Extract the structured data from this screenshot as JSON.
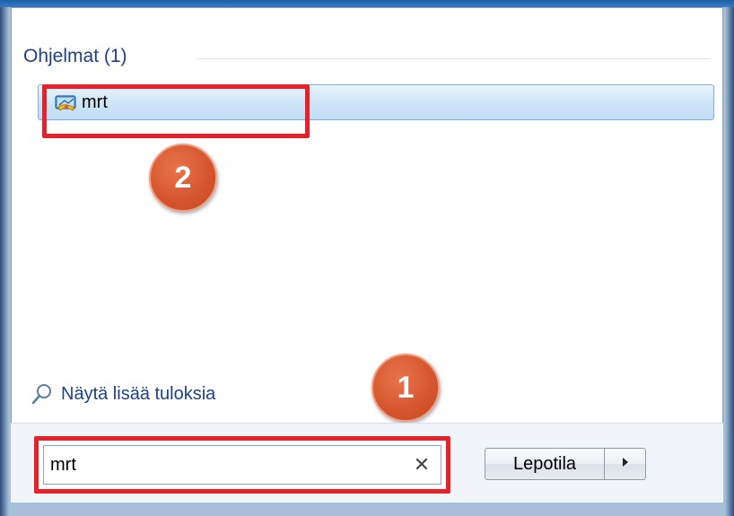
{
  "programs_section": {
    "heading": "Ohjelmat (1)",
    "results": [
      {
        "label": "mrt",
        "icon": "malicious-software-removal-tool-icon"
      }
    ]
  },
  "annotations": {
    "step_1": "1",
    "step_2": "2",
    "highlight_color": "#e8202a",
    "badge_color": "#d4552d"
  },
  "more_results": {
    "label": "Näytä lisää tuloksia",
    "icon": "search-icon"
  },
  "search": {
    "value": "mrt",
    "clear_icon": "close-icon"
  },
  "power": {
    "button_label": "Lepotila",
    "arrow_icon": "arrow-right-icon"
  }
}
